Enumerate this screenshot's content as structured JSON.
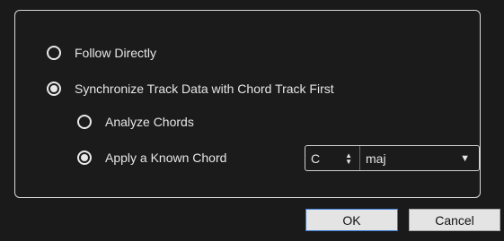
{
  "dialog": {
    "options": {
      "follow_directly": {
        "label": "Follow Directly",
        "selected": false
      },
      "synchronize_first": {
        "label": "Synchronize Track Data with Chord Track First",
        "selected": true
      },
      "analyze_chords": {
        "label": "Analyze Chords",
        "selected": false
      },
      "apply_known_chord": {
        "label": "Apply a Known Chord",
        "selected": true
      }
    },
    "chord": {
      "root_value": "C",
      "type_value": "maj"
    },
    "buttons": {
      "ok_label": "OK",
      "cancel_label": "Cancel"
    },
    "icons": {
      "stepper": "up-down-stepper-icon",
      "dropdown": "dropdown-arrow-icon"
    },
    "colors": {
      "background": "#1a1a1a",
      "border": "#d8d8d8",
      "text": "#e6e6e6",
      "ok_focus_border": "#3b7bd6"
    }
  }
}
